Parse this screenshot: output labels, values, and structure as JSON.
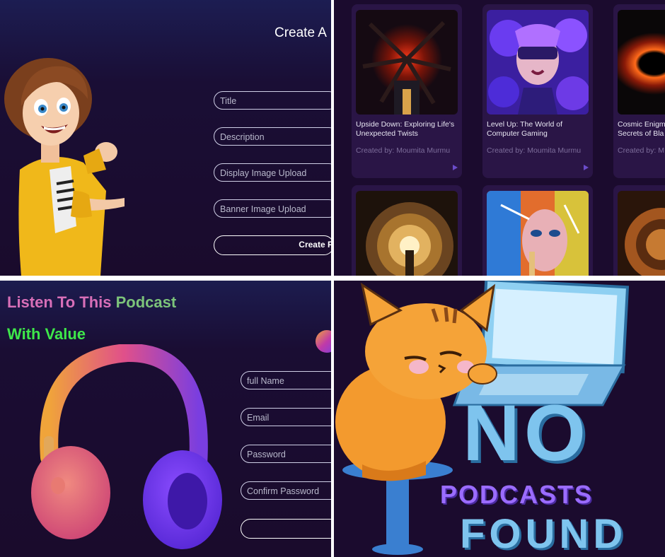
{
  "create_form": {
    "heading": "Create A",
    "title_placeholder": "Title",
    "description_placeholder": "Description",
    "display_image_placeholder": "Display Image Upload",
    "banner_image_placeholder": "Banner Image Upload",
    "submit_label": "Create P"
  },
  "podcasts": {
    "cards": [
      {
        "title": "Upside Down: Exploring Life's Unexpected Twists",
        "creator": "Created by: Moumita Murmu"
      },
      {
        "title": "Level Up: The World of Computer Gaming",
        "creator": "Created by: Moumita Murmu"
      },
      {
        "title": "Cosmic Enigm Secrets of Bla",
        "creator": "Created by: M"
      }
    ]
  },
  "signup": {
    "headline_part1": "Listen To This",
    "headline_part2": "Podcast",
    "headline_line2": "With Value",
    "full_name_placeholder": "full Name",
    "email_placeholder": "Email",
    "password_placeholder": "Password",
    "confirm_password_placeholder": "Confirm Password",
    "submit_label": ""
  },
  "empty_state": {
    "line1": "NO",
    "line2": "PODCASTS",
    "line3": "FOUND"
  },
  "colors": {
    "background": "#1b0b2e",
    "card": "#2a1546",
    "headline_pink": "#d86fb8",
    "headline_green": "#3ee84a",
    "empty_blue": "#7ec4ee",
    "empty_purple": "#9b6cff"
  }
}
